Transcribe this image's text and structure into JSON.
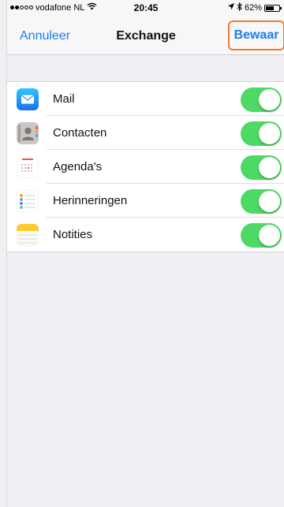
{
  "status_bar": {
    "carrier": "vodafone NL",
    "time": "20:45",
    "battery": "62%",
    "battery_level": 0.62,
    "signal_bars_filled": 2,
    "signal_bars_total": 5,
    "icons": [
      "signal-dots-icon",
      "wifi-icon",
      "location-arrow-icon",
      "bluetooth-icon",
      "battery-icon"
    ]
  },
  "navbar": {
    "cancel_label": "Annuleer",
    "title": "Exchange",
    "save_label": "Bewaar"
  },
  "accounts": [
    {
      "label": "Mail",
      "icon": "mail-icon",
      "enabled": true
    },
    {
      "label": "Contacten",
      "icon": "contacts-icon",
      "enabled": true
    },
    {
      "label": "Agenda's",
      "icon": "calendar-icon",
      "enabled": true
    },
    {
      "label": "Herinneringen",
      "icon": "reminders-icon",
      "enabled": true
    },
    {
      "label": "Notities",
      "icon": "notes-icon",
      "enabled": true
    }
  ],
  "colors": {
    "accent": "#1b7cf5",
    "toggle_on": "#4cd964",
    "highlight_border": "#ef7e2d",
    "background": "#efeff4"
  }
}
